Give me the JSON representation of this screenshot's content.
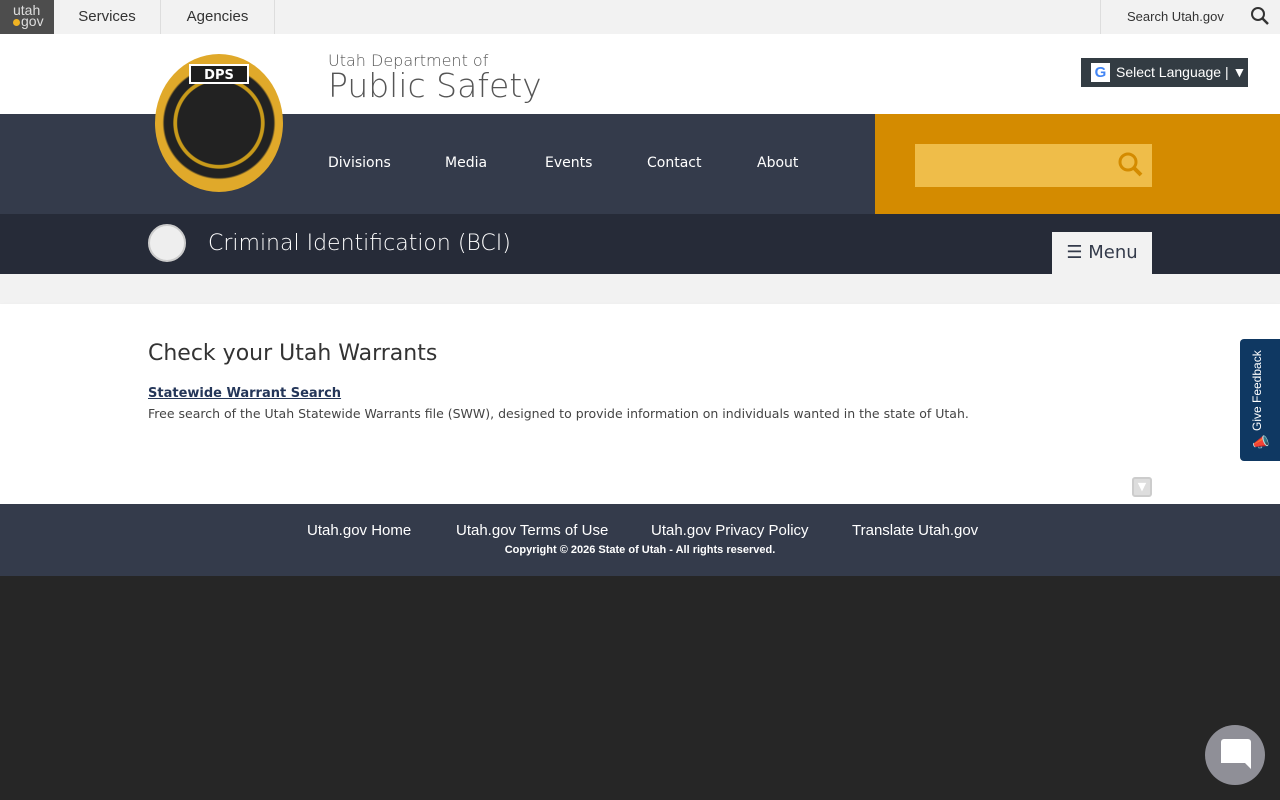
{
  "topbar": {
    "logo": "utah",
    "logo_sub": "gov",
    "services": "Services",
    "agencies": "Agencies",
    "search": "Search Utah.gov"
  },
  "header": {
    "dept_small": "Utah Department of",
    "dept_big": "Public Safety",
    "seal_text": "DPS",
    "language": "Select Language"
  },
  "nav": [
    "Divisions",
    "Media",
    "Events",
    "Contact",
    "About"
  ],
  "section": {
    "title": "Criminal Identification (BCI)",
    "menu": "Menu"
  },
  "main": {
    "heading": "Check your Utah Warrants",
    "link": "Statewide Warrant Search",
    "description": "Free search of the Utah Statewide Warrants file (SWW), designed to provide information on individuals wanted in the state of Utah."
  },
  "footer": {
    "links": [
      "Utah.gov Home",
      "Utah.gov Terms of Use",
      "Utah.gov Privacy Policy",
      "Translate Utah.gov"
    ],
    "copyright": "Copyright © 2026 State of Utah - All rights reserved."
  },
  "feedback": "Give Feedback",
  "colors": {
    "nav": "#343b4b",
    "accent": "#d48b00",
    "feedback": "#0f3862"
  }
}
